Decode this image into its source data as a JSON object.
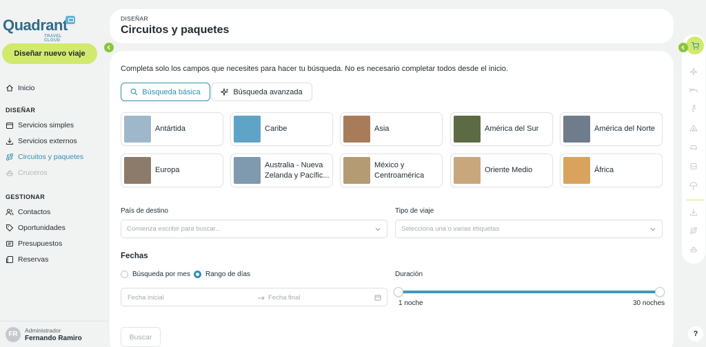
{
  "app": {
    "logo_text": "Quadrant",
    "logo_sub": "TRAVEL CLOUD",
    "new_trip_label": "Diseñar nuevo viaje"
  },
  "sidebar": {
    "home": "Inicio",
    "section_design": "DISEÑAR",
    "design_items": [
      {
        "label": "Servicios simples",
        "icon": "calendar-icon"
      },
      {
        "label": "Servicios externos",
        "icon": "download-icon"
      },
      {
        "label": "Circuitos y paquetes",
        "icon": "route-icon",
        "active": true
      },
      {
        "label": "Cruceros",
        "icon": "ship-icon",
        "disabled": true
      }
    ],
    "section_manage": "GESTIONAR",
    "manage_items": [
      {
        "label": "Contactos",
        "icon": "contacts-icon"
      },
      {
        "label": "Oportunidades",
        "icon": "tag-icon"
      },
      {
        "label": "Presupuestos",
        "icon": "quote-icon"
      },
      {
        "label": "Reservas",
        "icon": "bookings-icon"
      }
    ]
  },
  "user": {
    "initials": "FR",
    "role": "Administrador",
    "name": "Fernando Ramiro"
  },
  "header": {
    "eyebrow": "DISEÑAR",
    "title": "Circuitos y paquetes"
  },
  "main": {
    "intro": "Completa solo los campos que necesites para hacer tu búsqueda. No es necesario completar todos desde el inicio.",
    "tabs": [
      {
        "label": "Búsqueda básica",
        "icon": "search-icon",
        "selected": true
      },
      {
        "label": "Búsqueda avanzada",
        "icon": "sparkle-icon",
        "selected": false
      }
    ],
    "destinations": [
      {
        "label": "Antártida",
        "color": "#9fb8c9"
      },
      {
        "label": "Caribe",
        "color": "#5fa3c7"
      },
      {
        "label": "Asia",
        "color": "#a87c5a"
      },
      {
        "label": "América del Sur",
        "color": "#5d6b45"
      },
      {
        "label": "América del Norte",
        "color": "#6f7c8c"
      },
      {
        "label": "Europa",
        "color": "#8c7b6a"
      },
      {
        "label": "Australia - Nueva Zelanda y Pacífic...",
        "color": "#7f9aae"
      },
      {
        "label": "México y Centroamérica",
        "color": "#b59b73"
      },
      {
        "label": "Oriente Medio",
        "color": "#c9a77d"
      },
      {
        "label": "África",
        "color": "#d9a35e"
      }
    ],
    "destination_label": "País de destino",
    "destination_placeholder": "Comienza escribir para buscar...",
    "trip_type_label": "Tipo de viaje",
    "trip_type_placeholder": "Selecciona una o varias etiquetas",
    "dates_title": "Fechas",
    "radio_month": "Búsqueda por mes",
    "radio_range": "Rango de días",
    "start_placeholder": "Fecha inicial",
    "end_placeholder": "Fecha final",
    "duration_label": "Duración",
    "duration_min": "1 noche",
    "duration_max": "30 noches",
    "search_button": "Buscar"
  },
  "help": "?",
  "colors": {
    "accent": "#2e8fb0",
    "lime": "#d1ea6d",
    "toggle": "#8ac43f"
  }
}
